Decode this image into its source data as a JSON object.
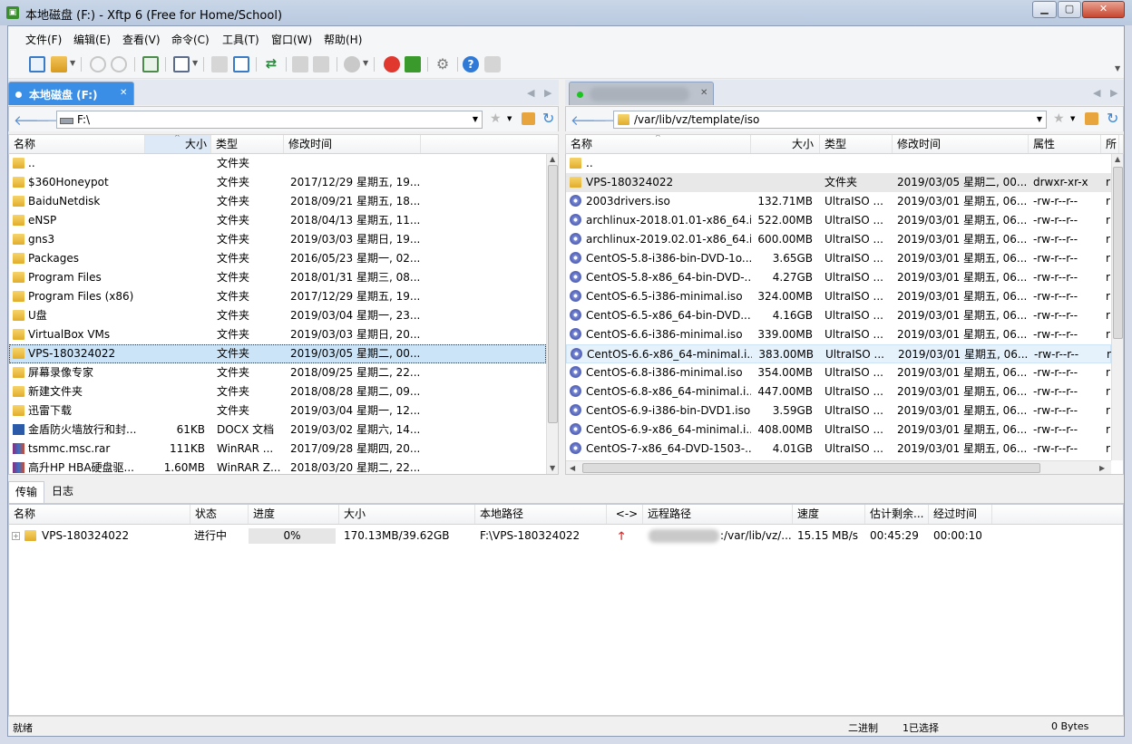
{
  "window": {
    "title": "本地磁盘 (F:) - Xftp 6 (Free for Home/School)",
    "min": "▁",
    "max": "▢",
    "close": "✕"
  },
  "menu": [
    "文件(F)",
    "编辑(E)",
    "查看(V)",
    "命令(C)",
    "工具(T)",
    "窗口(W)",
    "帮助(H)"
  ],
  "toolbar_icons": [
    "new-session-icon",
    "open-folder-icon",
    "connect-icon",
    "disconnect-icon",
    "new-tab-icon",
    "play-icon",
    "copy-file-icon",
    "paste-file-icon",
    "sync-icon",
    "properties-icon",
    "delete-icon",
    "status-icon",
    "xshell-icon",
    "xftp-icon",
    "settings-icon",
    "help-icon",
    "chat-icon"
  ],
  "left": {
    "tab": "本地磁盘 (F:)",
    "path": "F:\\",
    "headers": [
      "名称",
      "大小",
      "类型",
      "修改时间"
    ],
    "rows": [
      {
        "icon": "folder",
        "name": "..",
        "size": "",
        "type": "文件夹",
        "date": ""
      },
      {
        "icon": "folder",
        "name": "$360Honeypot",
        "size": "",
        "type": "文件夹",
        "date": "2017/12/29 星期五, 19..."
      },
      {
        "icon": "folder",
        "name": "BaiduNetdisk",
        "size": "",
        "type": "文件夹",
        "date": "2018/09/21 星期五, 18..."
      },
      {
        "icon": "folder",
        "name": "eNSP",
        "size": "",
        "type": "文件夹",
        "date": "2018/04/13 星期五, 11..."
      },
      {
        "icon": "folder",
        "name": "gns3",
        "size": "",
        "type": "文件夹",
        "date": "2019/03/03 星期日, 19..."
      },
      {
        "icon": "folder",
        "name": "Packages",
        "size": "",
        "type": "文件夹",
        "date": "2016/05/23 星期一, 02..."
      },
      {
        "icon": "folder",
        "name": "Program Files",
        "size": "",
        "type": "文件夹",
        "date": "2018/01/31 星期三, 08..."
      },
      {
        "icon": "folder",
        "name": "Program Files (x86)",
        "size": "",
        "type": "文件夹",
        "date": "2017/12/29 星期五, 19..."
      },
      {
        "icon": "folder",
        "name": "U盘",
        "size": "",
        "type": "文件夹",
        "date": "2019/03/04 星期一, 23..."
      },
      {
        "icon": "folder",
        "name": "VirtualBox VMs",
        "size": "",
        "type": "文件夹",
        "date": "2019/03/03 星期日, 20..."
      },
      {
        "icon": "folder",
        "name": "VPS-180324022",
        "size": "",
        "type": "文件夹",
        "date": "2019/03/05 星期二, 00...",
        "selected": true
      },
      {
        "icon": "folder",
        "name": "屏幕录像专家",
        "size": "",
        "type": "文件夹",
        "date": "2018/09/25 星期二, 22..."
      },
      {
        "icon": "folder",
        "name": "新建文件夹",
        "size": "",
        "type": "文件夹",
        "date": "2018/08/28 星期二, 09..."
      },
      {
        "icon": "folder",
        "name": "迅雷下载",
        "size": "",
        "type": "文件夹",
        "date": "2019/03/04 星期一, 12..."
      },
      {
        "icon": "docx",
        "name": "金盾防火墙放行和封...",
        "size": "61KB",
        "type": "DOCX 文档",
        "date": "2019/03/02 星期六, 14..."
      },
      {
        "icon": "rar",
        "name": "tsmmc.msc.rar",
        "size": "111KB",
        "type": "WinRAR ...",
        "date": "2017/09/28 星期四, 20..."
      },
      {
        "icon": "rar",
        "name": "高升HP HBA硬盘驱...",
        "size": "1.60MB",
        "type": "WinRAR Z...",
        "date": "2018/03/20 星期二, 22..."
      }
    ]
  },
  "right": {
    "path": "/var/lib/vz/template/iso",
    "headers": [
      "名称",
      "大小",
      "类型",
      "修改时间",
      "属性",
      "所"
    ],
    "rows": [
      {
        "icon": "folder",
        "name": "..",
        "size": "",
        "type": "",
        "date": "",
        "attr": "",
        "o": ""
      },
      {
        "icon": "folder",
        "name": "VPS-180324022",
        "size": "",
        "type": "文件夹",
        "date": "2019/03/05 星期二, 00...",
        "attr": "drwxr-xr-x",
        "o": "r",
        "hl": true
      },
      {
        "icon": "iso",
        "name": "2003drivers.iso",
        "size": "132.71MB",
        "type": "UltraISO ...",
        "date": "2019/03/01 星期五, 06...",
        "attr": "-rw-r--r--",
        "o": "r"
      },
      {
        "icon": "iso",
        "name": "archlinux-2018.01.01-x86_64.i...",
        "size": "522.00MB",
        "type": "UltraISO ...",
        "date": "2019/03/01 星期五, 06...",
        "attr": "-rw-r--r--",
        "o": "r"
      },
      {
        "icon": "iso",
        "name": "archlinux-2019.02.01-x86_64.i...",
        "size": "600.00MB",
        "type": "UltraISO ...",
        "date": "2019/03/01 星期五, 06...",
        "attr": "-rw-r--r--",
        "o": "r"
      },
      {
        "icon": "iso",
        "name": "CentOS-5.8-i386-bin-DVD-1o...",
        "size": "3.65GB",
        "type": "UltraISO ...",
        "date": "2019/03/01 星期五, 06...",
        "attr": "-rw-r--r--",
        "o": "r"
      },
      {
        "icon": "iso",
        "name": "CentOS-5.8-x86_64-bin-DVD-...",
        "size": "4.27GB",
        "type": "UltraISO ...",
        "date": "2019/03/01 星期五, 06...",
        "attr": "-rw-r--r--",
        "o": "r"
      },
      {
        "icon": "iso",
        "name": "CentOS-6.5-i386-minimal.iso",
        "size": "324.00MB",
        "type": "UltraISO ...",
        "date": "2019/03/01 星期五, 06...",
        "attr": "-rw-r--r--",
        "o": "r"
      },
      {
        "icon": "iso",
        "name": "CentOS-6.5-x86_64-bin-DVD...",
        "size": "4.16GB",
        "type": "UltraISO ...",
        "date": "2019/03/01 星期五, 06...",
        "attr": "-rw-r--r--",
        "o": "r"
      },
      {
        "icon": "iso",
        "name": "CentOS-6.6-i386-minimal.iso",
        "size": "339.00MB",
        "type": "UltraISO ...",
        "date": "2019/03/01 星期五, 06...",
        "attr": "-rw-r--r--",
        "o": "r"
      },
      {
        "icon": "iso",
        "name": "CentOS-6.6-x86_64-minimal.i...",
        "size": "383.00MB",
        "type": "UltraISO ...",
        "date": "2019/03/01 星期五, 06...",
        "attr": "-rw-r--r--",
        "o": "r",
        "hover": true
      },
      {
        "icon": "iso",
        "name": "CentOS-6.8-i386-minimal.iso",
        "size": "354.00MB",
        "type": "UltraISO ...",
        "date": "2019/03/01 星期五, 06...",
        "attr": "-rw-r--r--",
        "o": "r"
      },
      {
        "icon": "iso",
        "name": "CentOS-6.8-x86_64-minimal.i...",
        "size": "447.00MB",
        "type": "UltraISO ...",
        "date": "2019/03/01 星期五, 06...",
        "attr": "-rw-r--r--",
        "o": "r"
      },
      {
        "icon": "iso",
        "name": "CentOS-6.9-i386-bin-DVD1.iso",
        "size": "3.59GB",
        "type": "UltraISO ...",
        "date": "2019/03/01 星期五, 06...",
        "attr": "-rw-r--r--",
        "o": "r"
      },
      {
        "icon": "iso",
        "name": "CentOS-6.9-x86_64-minimal.i...",
        "size": "408.00MB",
        "type": "UltraISO ...",
        "date": "2019/03/01 星期五, 06...",
        "attr": "-rw-r--r--",
        "o": "r"
      },
      {
        "icon": "iso",
        "name": "CentOS-7-x86_64-DVD-1503-...",
        "size": "4.01GB",
        "type": "UltraISO ...",
        "date": "2019/03/01 星期五, 06...",
        "attr": "-rw-r--r--",
        "o": "r"
      }
    ]
  },
  "bottom": {
    "tabs": [
      "传输",
      "日志"
    ],
    "headers": [
      "名称",
      "状态",
      "进度",
      "大小",
      "本地路径",
      "<->",
      "远程路径",
      "速度",
      "估计剩余...",
      "经过时间"
    ],
    "transfer": {
      "name": "VPS-180324022",
      "status": "进行中",
      "progress": "0%",
      "size": "170.13MB/39.62GB",
      "local": "F:\\VPS-180324022",
      "remote": ":/var/lib/vz/...",
      "speed": "15.15 MB/s",
      "eta": "00:45:29",
      "elapsed": "00:00:10"
    }
  },
  "status": {
    "left": "就绪",
    "mode": "二进制",
    "selected": "1已选择",
    "bytes": "0 Bytes"
  }
}
